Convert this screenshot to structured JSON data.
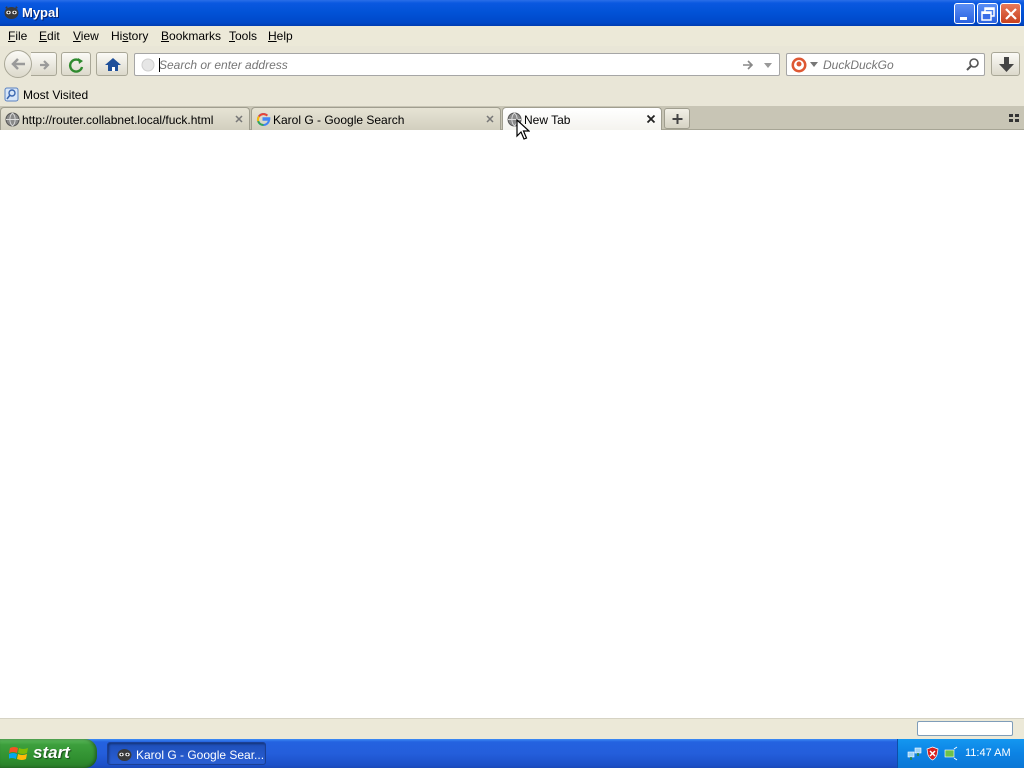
{
  "window": {
    "title": "Mypal",
    "icon": "mypal-raccoon-icon",
    "controls": [
      "minimize-icon",
      "restore-icon",
      "close-icon"
    ]
  },
  "menubar": {
    "items": [
      {
        "label": "File",
        "mnemonic": "F"
      },
      {
        "label": "Edit",
        "mnemonic": "E"
      },
      {
        "label": "View",
        "mnemonic": "V"
      },
      {
        "label": "History",
        "mnemonic": "s"
      },
      {
        "label": "Bookmarks",
        "mnemonic": "B"
      },
      {
        "label": "Tools",
        "mnemonic": "T"
      },
      {
        "label": "Help",
        "mnemonic": "H"
      }
    ]
  },
  "navbar": {
    "url_value": "",
    "url_placeholder": "Search or enter address",
    "search_engine": "DuckDuckGo",
    "search_placeholder": "DuckDuckGo",
    "icons": [
      "back-arrow-icon",
      "forward-arrow-icon",
      "reload-icon",
      "home-icon",
      "go-arrow-icon",
      "dropdown-icon",
      "search-magnifier-icon",
      "download-arrow-icon"
    ]
  },
  "bookmarks": {
    "items": [
      {
        "label": "Most Visited",
        "icon": "most-visited-icon"
      }
    ]
  },
  "tabs": [
    {
      "label": "http://router.collabnet.local/fuck.html",
      "icon": "globe-icon",
      "active": false
    },
    {
      "label": "Karol G - Google Search",
      "icon": "google-g-icon",
      "active": false
    },
    {
      "label": "New Tab",
      "icon": "globe-icon",
      "active": true
    }
  ],
  "taskbar": {
    "start_label": "start",
    "task_label": "Karol G - Google Sear...",
    "clock": "11:47 AM"
  },
  "colors": {
    "titlebar": "#0152d6",
    "taskbar": "#245edb",
    "start_button": "#3d9f3d",
    "systray": "#0c83e4",
    "chrome": "#ece9d8",
    "content": "#ffffff"
  }
}
